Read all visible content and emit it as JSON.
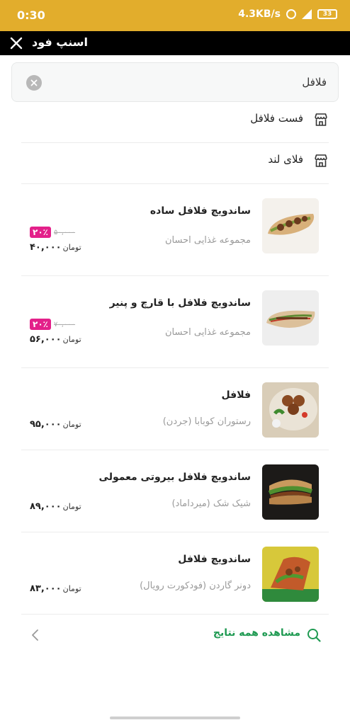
{
  "status_bar": {
    "time": "0:30",
    "speed": "4.3KB/s",
    "battery": "33"
  },
  "header": {
    "title": "اسنپ فود"
  },
  "search": {
    "value": "فلافل",
    "placeholder": ""
  },
  "vendors": [
    {
      "name": "فست فلافل",
      "icon": "store-icon"
    },
    {
      "name": "فلای لند",
      "icon": "store-icon"
    }
  ],
  "products": [
    {
      "name": "ساندویچ فلافل ساده",
      "vendor": "مجموعه غذایی احسان",
      "price": "۴۰,۰۰۰",
      "unit": "تومان",
      "discount": "۲۰٪",
      "old_price": "۵۰,۰۰۰"
    },
    {
      "name": "ساندویچ فلافل با قارچ و پنیر",
      "vendor": "مجموعه غذایی احسان",
      "price": "۵۶,۰۰۰",
      "unit": "تومان",
      "discount": "۲۰٪",
      "old_price": "۷۰,۰۰۰"
    },
    {
      "name": "فلافل",
      "vendor": "رستوران کوبابا (جردن)",
      "price": "۹۵,۰۰۰",
      "unit": "تومان"
    },
    {
      "name": "ساندویچ فلافل بیروتی معمولی",
      "vendor": "شیک شک (میرداماد)",
      "price": "۸۹,۰۰۰",
      "unit": "تومان"
    },
    {
      "name": "ساندویچ فلافل",
      "vendor": "دونر گاردن (فودکورت رویال)",
      "price": "۸۳,۰۰۰",
      "unit": "تومان"
    }
  ],
  "see_all": {
    "label": "مشاهده همه نتایج"
  },
  "colors": {
    "status_bar": "#e2ad2c",
    "header": "#000000",
    "accent_green": "#1f9a52",
    "discount_pink": "#e3208a"
  }
}
